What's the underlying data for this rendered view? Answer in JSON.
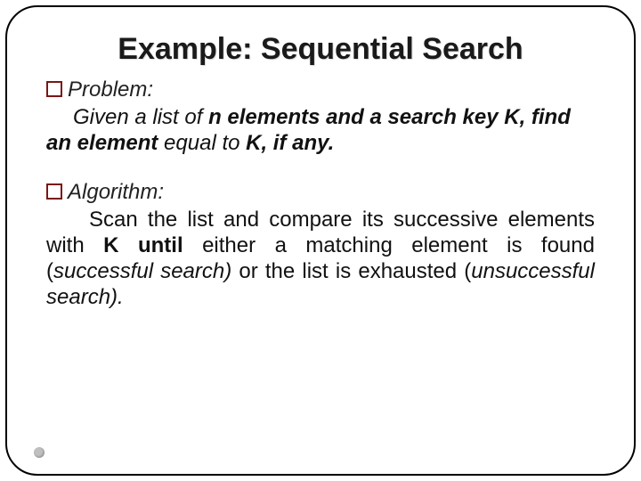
{
  "title": "Example: Sequential Search",
  "problem": {
    "label": "Problem:",
    "body_prefix": "Given a list of ",
    "body_bold": "n elements and a search key K, find an element ",
    "body_mid": "equal to ",
    "body_bold2": "K, if any."
  },
  "algorithm": {
    "label": "Algorithm:",
    "p1": "Scan the list and compare its successive elements with ",
    "p1_bold": "K until ",
    "p1_mid": "either a matching element is found (",
    "p1_ital1": "successful search) ",
    "p1_mid2": "or the list is exhausted (",
    "p1_ital2": "unsuccessful search).",
    "p1_end": ""
  }
}
